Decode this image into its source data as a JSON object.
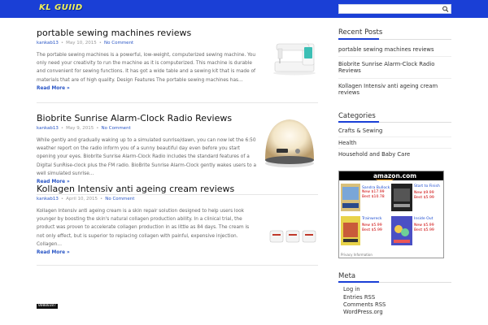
{
  "header": {
    "logo_text": "KL GUIID",
    "search_placeholder": ""
  },
  "posts": [
    {
      "title": "portable sewing machines reviews",
      "author": "kankab13",
      "date": "May 10, 2015",
      "comments": "No Comment",
      "excerpt": "The portable sewing machines is a powerful, low-weight, computerized sewing machine. You only need your creativity to run the machine as it is computerized. This machine is durable and convenient for sewing functions. It has got a wide table and a sewing kit that is made of materials that are of high quality. Design Features The portable sewing machines has…",
      "read_more": "Read More »"
    },
    {
      "title": "Biobrite Sunrise Alarm-Clock Radio Reviews",
      "author": "kankab13",
      "date": "May 9, 2015",
      "comments": "No Comment",
      "excerpt": "While gently and gradually waking up to a simulated sunrise/dawn, you can now let the 6:50 weather report on the radio inform you of a sunny beautiful day even before you start opening your eyes. Biobrite Sunrise Alarm-Clock Radio includes the standard features of a Digital SunRise-clock plus the FM radio. BioBrite Sunrise Alarm-Clock gently wakes users to a well simulated sunrise…",
      "read_more": "Read More »"
    },
    {
      "title": "Kollagen Intensiv anti ageing cream reviews",
      "author": "kankab13",
      "date": "April 10, 2015",
      "comments": "No Comment",
      "excerpt": "Kollagen Intensiv anti ageing cream is a skin repair solution designed to help users look younger by boosting the skin's natural collagen production ability. In a clinical trial, the product was proven to accelerate collagen production in as little as 84 days. The cream is not only effect, but is superior to replacing collagen with painful, expensive injection. Collagen…",
      "read_more": "Read More »"
    }
  ],
  "sidebar": {
    "recent_title": "Recent Posts",
    "recent": [
      "portable sewing machines reviews",
      "Biobrite Sunrise Alarm-Clock Radio Reviews",
      "Kollagen Intensiv anti ageing cream reviews"
    ],
    "categories_title": "Categories",
    "categories": [
      "Crafts & Sewing",
      "Health",
      "Household and Baby Care"
    ],
    "meta_title": "Meta",
    "meta": [
      "Log in",
      "Entries RSS",
      "Comments RSS",
      "WordPress.org"
    ]
  },
  "amazon": {
    "logo": "amazon.com",
    "items": [
      {
        "title": "Sandra Bullock...",
        "new": "New $17.99",
        "best": "Best $10.78"
      },
      {
        "title": "Start to Finish",
        "new": "New $9.99",
        "best": "Best $5.99"
      },
      {
        "title": "Trainwreck",
        "new": "New $5.99",
        "best": "Best $5.99"
      },
      {
        "title": "Inside Out",
        "new": "New $5.99",
        "best": "Best $5.99"
      }
    ],
    "info": "Privacy Information"
  },
  "counter": "00000387",
  "colors": {
    "brand_blue": "#1a3fd6",
    "link_blue": "#2a56c6",
    "logo_yellow": "#f2f25a"
  }
}
